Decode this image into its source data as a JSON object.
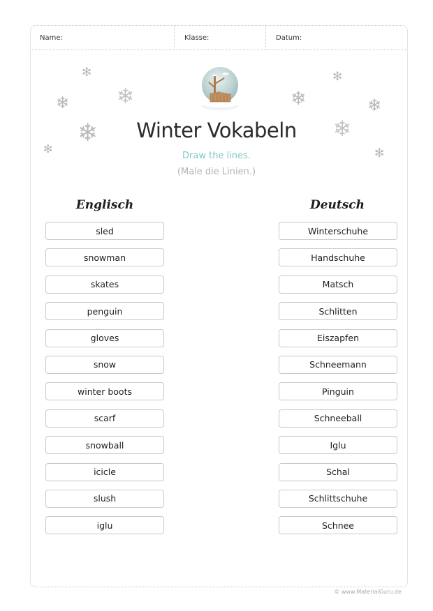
{
  "header": {
    "name_label": "Name:",
    "class_label": "Klasse:",
    "date_label": "Datum:"
  },
  "decor": {
    "snowflake_glyph": "❄",
    "snowflake_alt_glyph": "✻",
    "illustration": "snow-globe-icon"
  },
  "title": "Winter Vokabeln",
  "instruction_en": "Draw the lines.",
  "instruction_de": "(Male die Linien.)",
  "columns": {
    "left_heading": "Englisch",
    "right_heading": "Deutsch"
  },
  "english_words": [
    "sled",
    "snowman",
    "skates",
    "penguin",
    "gloves",
    "snow",
    "winter boots",
    "scarf",
    "snowball",
    "icicle",
    "slush",
    "iglu"
  ],
  "german_words": [
    "Winterschuhe",
    "Handschuhe",
    "Matsch",
    "Schlitten",
    "Eiszapfen",
    "Schneemann",
    "Pinguin",
    "Schneeball",
    "Iglu",
    "Schal",
    "Schlittschuhe",
    "Schnee"
  ],
  "footer": "© www.MaterialGuru.de",
  "colors": {
    "instruction_accent": "#7fc7c4",
    "snowflake": "#b8b8b8"
  }
}
